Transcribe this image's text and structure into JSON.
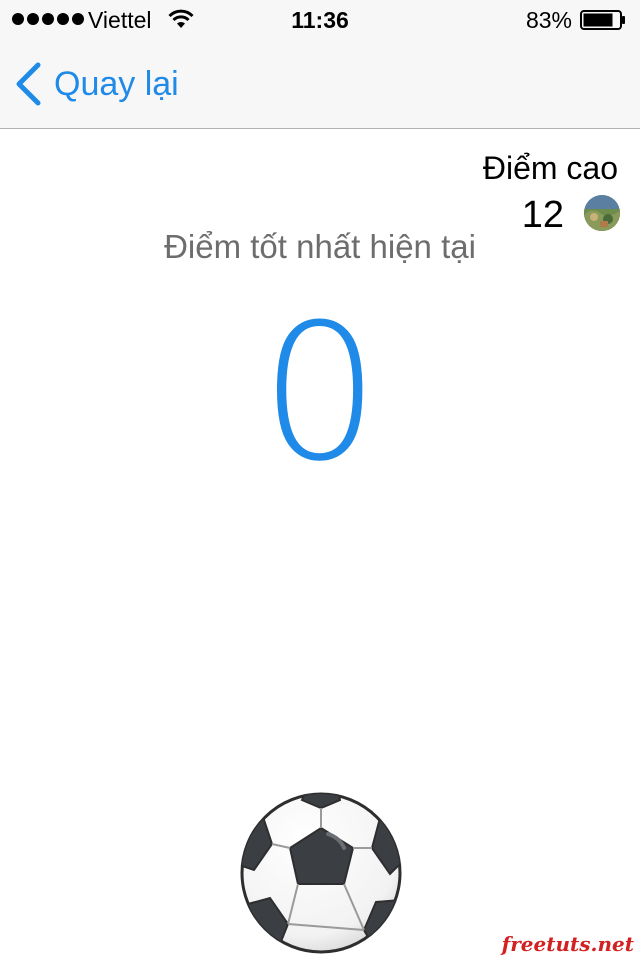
{
  "status_bar": {
    "carrier": "Viettel",
    "time": "11:36",
    "battery": "83%",
    "battery_level": 0.83,
    "signal_bars": 5
  },
  "nav": {
    "back_label": "Quay lại"
  },
  "highscore": {
    "title": "Điểm cao",
    "value": "12"
  },
  "current": {
    "label": "Điểm tốt nhất hiện tại",
    "score": "0"
  },
  "watermark": "freetuts.net",
  "colors": {
    "accent": "#1f8ae8",
    "label_gray": "#6d6d6d",
    "watermark": "#d32020"
  },
  "icons": {
    "back": "chevron-left-icon",
    "wifi": "wifi-icon",
    "battery": "battery-icon",
    "ball": "soccer-ball-icon"
  }
}
